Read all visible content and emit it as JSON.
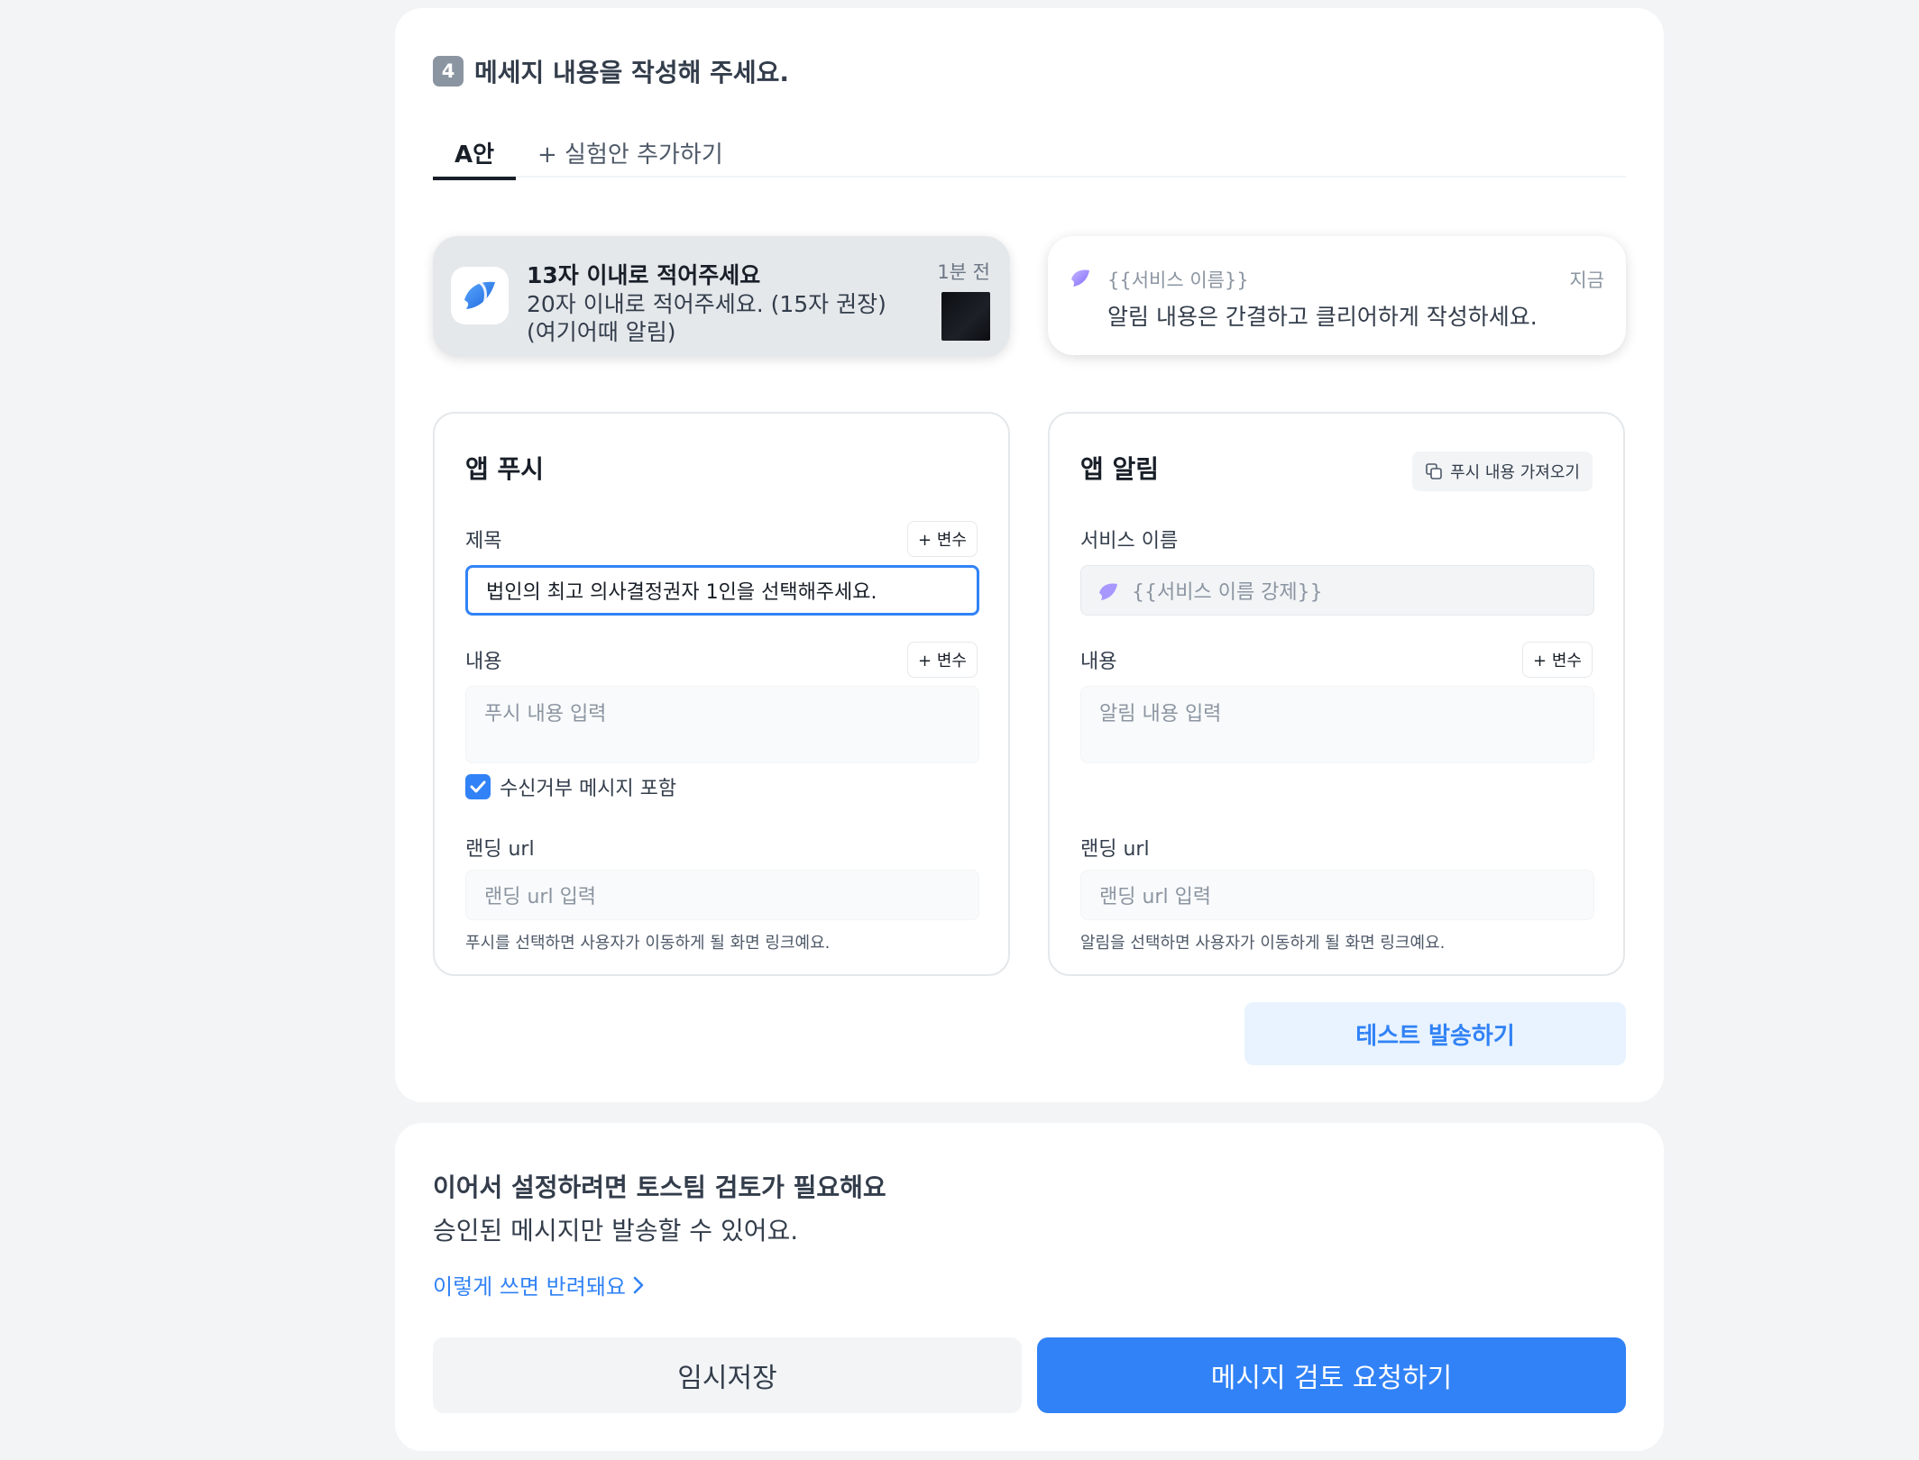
{
  "step": {
    "number": "4",
    "title": "메세지 내용을 작성해 주세요."
  },
  "tabs": {
    "a_label": "A안",
    "add_label": "+ 실험안 추가하기"
  },
  "push_preview": {
    "title": "13자 이내로 적어주세요",
    "body_line1": "20자 이내로 적어주세요. (15자 권장)",
    "body_line2": "(여기어때 알림)",
    "time": "1분 전"
  },
  "noti_preview": {
    "service": "{{서비스 이름}}",
    "time": "지금",
    "body": "알림 내용은 간결하고 클리어하게 작성하세요."
  },
  "push_form": {
    "title": "앱 푸시",
    "subject_label": "제목",
    "var_button": "+ 변수",
    "subject_value": "법인의 최고 의사결정권자 1인을 선택해주세요.",
    "content_label": "내용",
    "content_placeholder": "푸시 내용 입력",
    "optout_label": "수신거부 메시지 포함",
    "url_label": "랜딩 url",
    "url_placeholder": "랜딩 url 입력",
    "url_helper": "푸시를 선택하면 사용자가 이동하게 될 화면 링크예요."
  },
  "noti_form": {
    "title": "앱 알림",
    "import_button": "푸시 내용 가져오기",
    "service_label": "서비스 이름",
    "service_value": "{{서비스 이름 강제}}",
    "content_label": "내용",
    "var_button": "+ 변수",
    "content_placeholder": "알림 내용 입력",
    "url_label": "랜딩 url",
    "url_placeholder": "랜딩 url 입력",
    "url_helper": "알림을 선택하면 사용자가 이동하게 될 화면 링크예요."
  },
  "test_button": "테스트 발송하기",
  "review": {
    "title": "이어서 설정하려면 토스팀 검토가 필요해요",
    "subtitle": "승인된 메시지만 발송할 수 있어요.",
    "link": "이렇게 쓰면 반려돼요",
    "save_button": "임시저장",
    "request_button": "메시지 검토 요청하기"
  },
  "colors": {
    "accent": "#3182f6",
    "accent_light": "#e8f3ff",
    "background": "#f2f4f6"
  },
  "icons": {
    "app_icon": "toss-logo-icon",
    "service_icon": "service-logo-icon",
    "import_icon": "copy-icon",
    "checkbox": "check-icon",
    "link_arrow": "chevron-right-icon"
  }
}
